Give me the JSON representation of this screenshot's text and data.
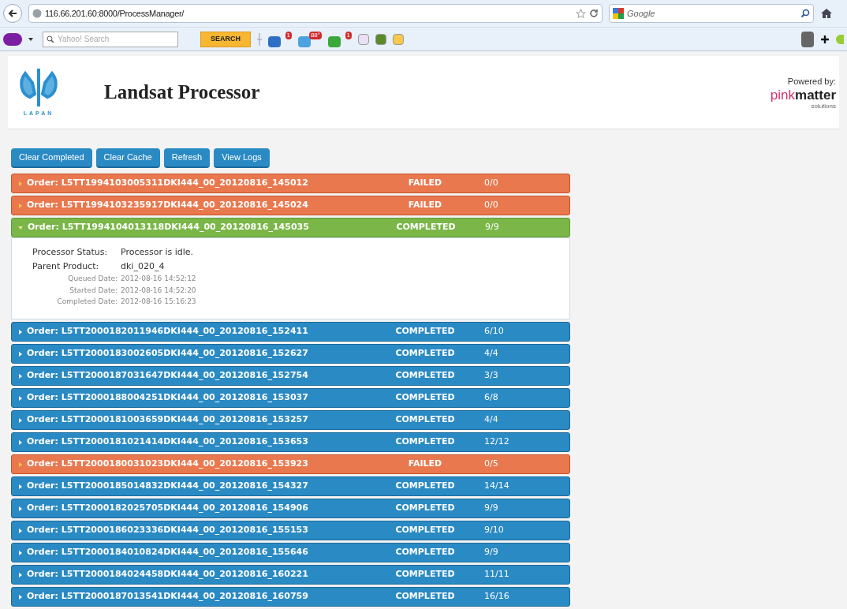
{
  "browser": {
    "address": "116.66.201.60:8000/ProcessManager/",
    "search_placeholder": "Google",
    "toolbar": {
      "search_placeholder": "Yahoo! Search",
      "search_button": "SEARCH",
      "badges": [
        "1",
        "88°",
        "1"
      ]
    }
  },
  "header": {
    "logo_text": "LAPAN",
    "title": "Landsat Processor",
    "powered_by": "Powered by:",
    "brand_light": "pink",
    "brand_bold": "matter",
    "brand_sub": "solutions"
  },
  "buttons": [
    "Clear Completed",
    "Clear Cache",
    "Refresh",
    "View Logs"
  ],
  "orders": [
    {
      "name": "Order: L5TT1994103005311DKI444_00_20120816_145012",
      "status": "FAILED",
      "kind": "failed",
      "progress": "0/0",
      "expanded": false
    },
    {
      "name": "Order: L5TT1994103235917DKI444_00_20120816_145024",
      "status": "FAILED",
      "kind": "failed",
      "progress": "0/0",
      "expanded": false
    },
    {
      "name": "Order: L5TT1994104013118DKI444_00_20120816_145035",
      "status": "COMPLETED",
      "kind": "completed",
      "progress": "9/9",
      "expanded": true,
      "details": [
        {
          "kind": "main",
          "label": "Processor Status:",
          "value": "Processor is idle."
        },
        {
          "kind": "main",
          "label": "Parent Product:",
          "value": "dki_020_4"
        },
        {
          "kind": "date",
          "label": "Queued Date:",
          "value": "2012-08-16 14:52:12"
        },
        {
          "kind": "date",
          "label": "Started Date:",
          "value": "2012-08-16 14:52:20"
        },
        {
          "kind": "date",
          "label": "Completed Date:",
          "value": "2012-08-16 15:16:23"
        }
      ]
    },
    {
      "name": "Order: L5TT2000182011946DKI444_00_20120816_152411",
      "status": "COMPLETED",
      "kind": "completed",
      "progress": "6/10",
      "expanded": false
    },
    {
      "name": "Order: L5TT2000183002605DKI444_00_20120816_152627",
      "status": "COMPLETED",
      "kind": "completed",
      "progress": "4/4",
      "expanded": false
    },
    {
      "name": "Order: L5TT2000187031647DKI444_00_20120816_152754",
      "status": "COMPLETED",
      "kind": "completed",
      "progress": "3/3",
      "expanded": false
    },
    {
      "name": "Order: L5TT2000188004251DKI444_00_20120816_153037",
      "status": "COMPLETED",
      "kind": "completed",
      "progress": "6/8",
      "expanded": false
    },
    {
      "name": "Order: L5TT2000181003659DKI444_00_20120816_153257",
      "status": "COMPLETED",
      "kind": "completed",
      "progress": "4/4",
      "expanded": false
    },
    {
      "name": "Order: L5TT2000181021414DKI444_00_20120816_153653",
      "status": "COMPLETED",
      "kind": "completed",
      "progress": "12/12",
      "expanded": false
    },
    {
      "name": "Order: L5TT2000180031023DKI444_00_20120816_153923",
      "status": "FAILED",
      "kind": "failed",
      "progress": "0/5",
      "expanded": false
    },
    {
      "name": "Order: L5TT2000185014832DKI444_00_20120816_154327",
      "status": "COMPLETED",
      "kind": "completed",
      "progress": "14/14",
      "expanded": false
    },
    {
      "name": "Order: L5TT2000182025705DKI444_00_20120816_154906",
      "status": "COMPLETED",
      "kind": "completed",
      "progress": "9/9",
      "expanded": false
    },
    {
      "name": "Order: L5TT2000186023336DKI444_00_20120816_155153",
      "status": "COMPLETED",
      "kind": "completed",
      "progress": "9/10",
      "expanded": false
    },
    {
      "name": "Order: L5TT2000184010824DKI444_00_20120816_155646",
      "status": "COMPLETED",
      "kind": "completed",
      "progress": "9/9",
      "expanded": false
    },
    {
      "name": "Order: L5TT2000184024458DKI444_00_20120816_160221",
      "status": "COMPLETED",
      "kind": "completed",
      "progress": "11/11",
      "expanded": false
    },
    {
      "name": "Order: L5TT2000187013541DKI444_00_20120816_160759",
      "status": "COMPLETED",
      "kind": "completed",
      "progress": "16/16",
      "expanded": false
    }
  ]
}
